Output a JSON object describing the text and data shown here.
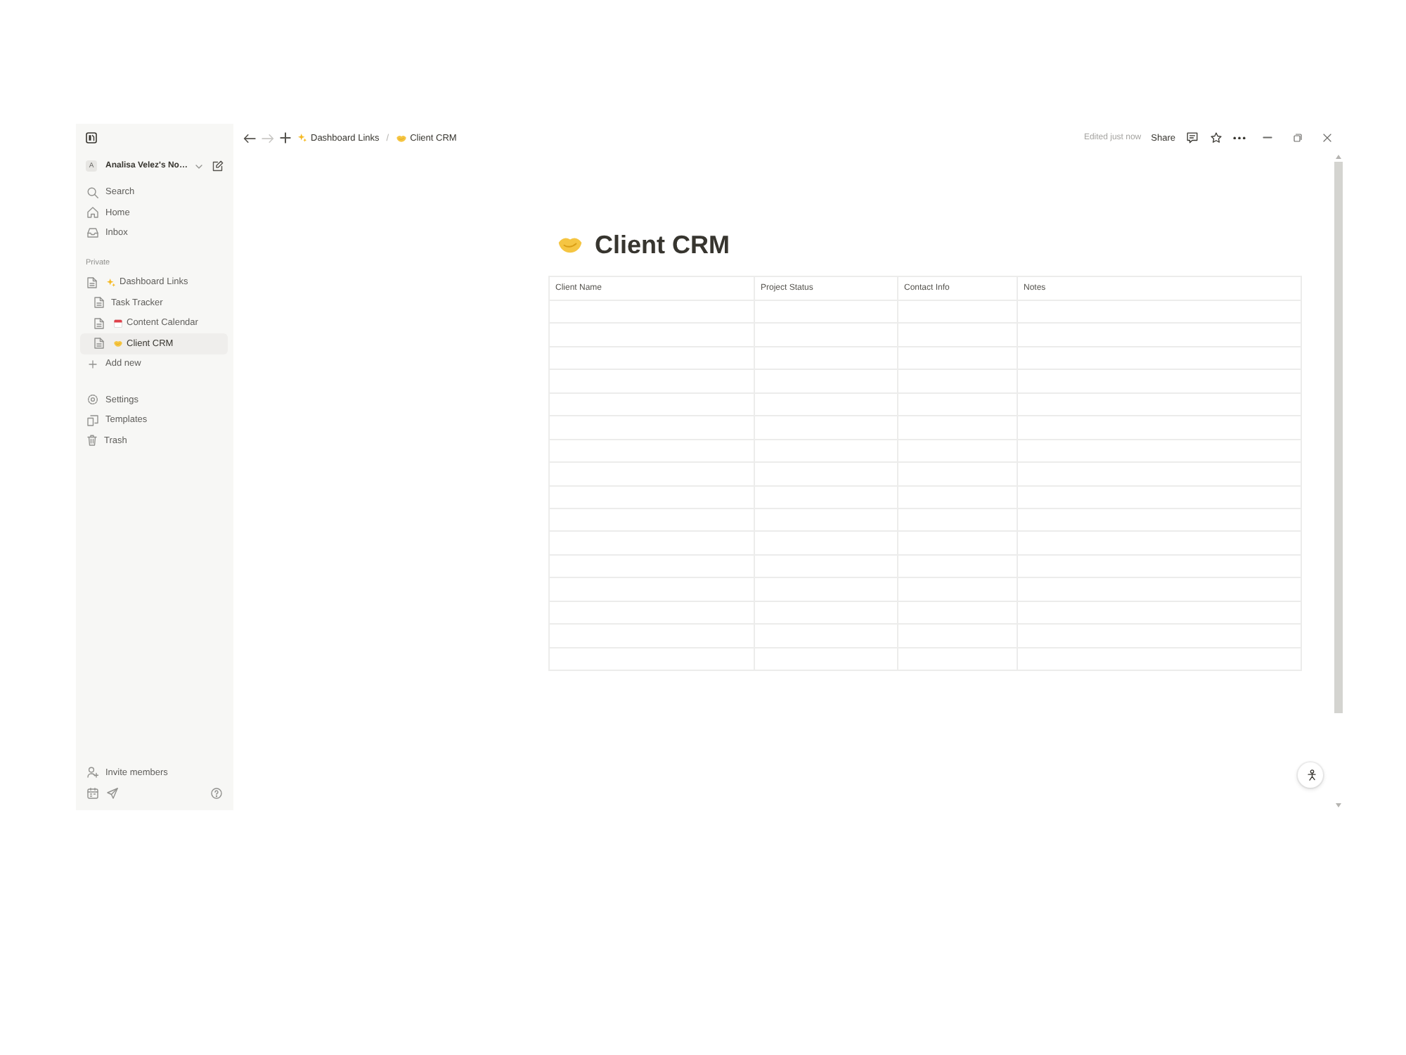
{
  "topbar": {
    "nav_buttons": [
      {
        "kind": "back",
        "disabled": false
      },
      {
        "kind": "forward",
        "disabled": true
      },
      {
        "kind": "new_tab",
        "disabled": false
      }
    ],
    "breadcrumbs": {
      "items": [
        {
          "kind": "sparkle",
          "label": "Dashboard Links"
        },
        {
          "kind": "handshake",
          "label": "Client CRM"
        }
      ],
      "separator": "/"
    },
    "edit_status": "Edited just now",
    "share": "Share",
    "actions": [
      {
        "kind": "comment"
      },
      {
        "kind": "favorite"
      },
      {
        "kind": "more"
      }
    ],
    "window_controls": [
      {
        "kind": "minimize"
      },
      {
        "kind": "restore"
      },
      {
        "kind": "close"
      }
    ]
  },
  "sidebar": {
    "workspace": {
      "avatar": "A",
      "name": "Analisa Velez's No…"
    },
    "nav": [
      {
        "kind": "search",
        "label": "Search"
      },
      {
        "kind": "home",
        "label": "Home"
      },
      {
        "kind": "inbox",
        "label": "Inbox"
      }
    ],
    "section_label": "Private",
    "pages": [
      {
        "kind": "sparkle",
        "label": "Dashboard Links",
        "selected": false,
        "children": [
          {
            "kind": "plain",
            "label": "Task Tracker",
            "selected": false
          },
          {
            "kind": "calendar",
            "label": "Content Calendar",
            "selected": false
          },
          {
            "kind": "handshake",
            "label": "Client CRM",
            "selected": true
          }
        ]
      }
    ],
    "add_new": "Add new",
    "tools": [
      {
        "kind": "settings",
        "label": "Settings"
      },
      {
        "kind": "templates",
        "label": "Templates"
      },
      {
        "kind": "trash",
        "label": "Trash"
      }
    ],
    "invite": "Invite members",
    "footer_icons": [
      {
        "kind": "calendar"
      },
      {
        "kind": "send"
      },
      {
        "kind": "help"
      }
    ]
  },
  "page": {
    "kind": "handshake",
    "title": "Client CRM",
    "table": {
      "columns": [
        "Client Name",
        "Project Status",
        "Contact Info",
        "Notes"
      ],
      "rows": [
        {
          "kind": "blank"
        },
        {
          "kind": "blank"
        },
        {
          "kind": "blank"
        },
        {
          "kind": "blank"
        },
        {
          "kind": "blank"
        },
        {
          "kind": "blank"
        },
        {
          "kind": "blank"
        },
        {
          "kind": "blank"
        },
        {
          "kind": "blank"
        },
        {
          "kind": "blank"
        },
        {
          "kind": "blank"
        },
        {
          "kind": "blank"
        },
        {
          "kind": "blank"
        },
        {
          "kind": "blank"
        },
        {
          "kind": "blank"
        },
        {
          "kind": "blank"
        }
      ]
    }
  }
}
